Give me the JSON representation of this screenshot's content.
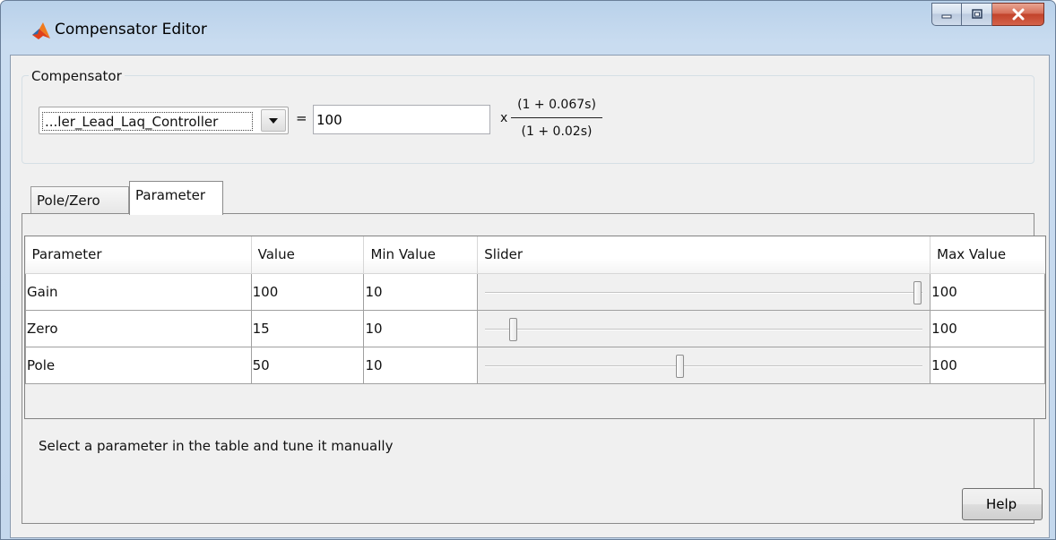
{
  "window": {
    "title": "Compensator Editor"
  },
  "compensator": {
    "group_label": "Compensator",
    "selected_name": "...ler_Lead_Laq_Controller",
    "equals": "=",
    "gain_value": "100",
    "times": "x",
    "numerator": "(1 + 0.067s)",
    "denominator": "(1 + 0.02s)"
  },
  "tabs": [
    {
      "label": "Pole/Zero",
      "active": false
    },
    {
      "label": "Parameter",
      "active": true
    }
  ],
  "table": {
    "headers": [
      "Parameter",
      "Value",
      "Min Value",
      "Slider",
      "Max Value"
    ],
    "rows": [
      {
        "parameter": "Gain",
        "value": "100",
        "min": "10",
        "max": "100",
        "slider_fraction": 1.0
      },
      {
        "parameter": "Zero",
        "value": "15",
        "min": "10",
        "max": "100",
        "slider_fraction": 0.0556
      },
      {
        "parameter": "Pole",
        "value": "50",
        "min": "10",
        "max": "100",
        "slider_fraction": 0.4444
      }
    ]
  },
  "status": {
    "text": "Select a parameter in the table and tune it manually"
  },
  "buttons": {
    "help_label": "Help"
  },
  "icons": {
    "app": "matlab-logo-icon",
    "minimize": "minimize-icon",
    "maximize": "maximize-icon",
    "close": "close-icon",
    "dropdown": "chevron-down-icon"
  }
}
